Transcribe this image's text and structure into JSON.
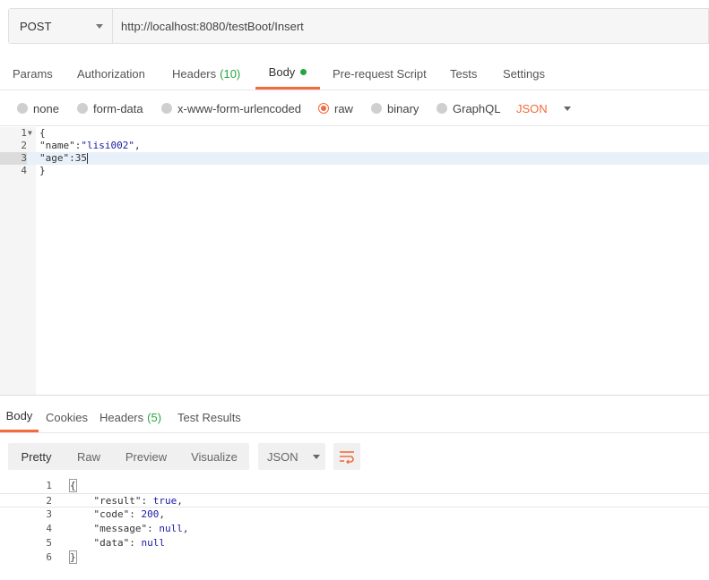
{
  "request": {
    "method": "POST",
    "url": "http://localhost:8080/testBoot/Insert"
  },
  "request_tabs": [
    {
      "label": "Params"
    },
    {
      "label": "Authorization"
    },
    {
      "label": "Headers",
      "count": "(10)"
    },
    {
      "label": "Body",
      "active": true,
      "indicator": "green-dot"
    },
    {
      "label": "Pre-request Script"
    },
    {
      "label": "Tests"
    },
    {
      "label": "Settings"
    }
  ],
  "body_types": {
    "options": [
      "none",
      "form-data",
      "x-www-form-urlencoded",
      "raw",
      "binary",
      "GraphQL"
    ],
    "selected": "raw",
    "format": "JSON"
  },
  "request_body": {
    "lines": [
      {
        "n": "1",
        "text": "{"
      },
      {
        "n": "2",
        "key": "\"name\"",
        "sep": ":",
        "val": "\"lisi002\"",
        "tail": ","
      },
      {
        "n": "3",
        "key": "\"age\"",
        "sep": ":",
        "val": "35",
        "tail": ""
      },
      {
        "n": "4",
        "text": "}"
      }
    ],
    "highlighted_line": "3"
  },
  "response_tabs": [
    {
      "label": "Body",
      "active": true
    },
    {
      "label": "Cookies"
    },
    {
      "label": "Headers",
      "count": "(5)"
    },
    {
      "label": "Test Results"
    }
  ],
  "response_toolbar": {
    "views": [
      "Pretty",
      "Raw",
      "Preview",
      "Visualize"
    ],
    "active_view": "Pretty",
    "format": "JSON"
  },
  "response_body": {
    "lines": [
      {
        "n": "1",
        "text": "{"
      },
      {
        "n": "2",
        "key": "\"result\"",
        "val": "true",
        "tail": ","
      },
      {
        "n": "3",
        "key": "\"code\"",
        "val": "200",
        "tail": ","
      },
      {
        "n": "4",
        "key": "\"message\"",
        "val": "null",
        "tail": ","
      },
      {
        "n": "5",
        "key": "\"data\"",
        "val": "null",
        "tail": ""
      },
      {
        "n": "6",
        "text": "}"
      }
    ]
  },
  "colors": {
    "accent": "#f26b3a",
    "success": "#26a541",
    "string": "#1a1aa6"
  }
}
